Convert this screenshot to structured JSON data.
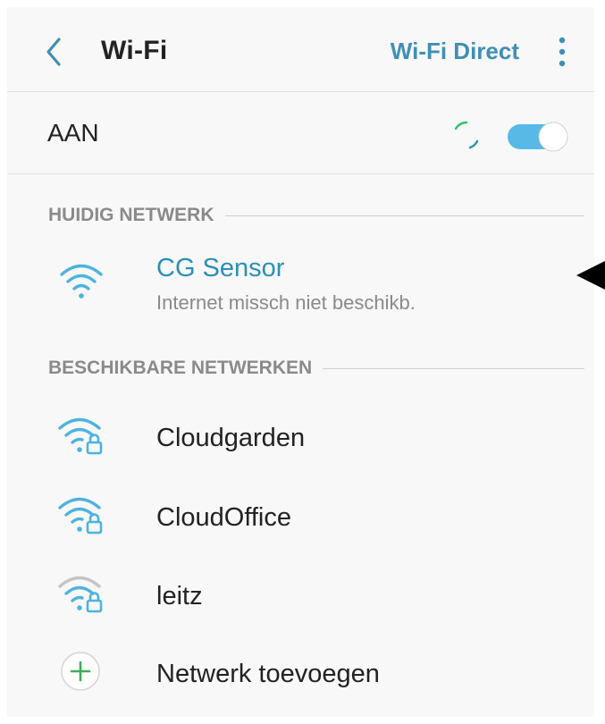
{
  "header": {
    "title": "Wi-Fi",
    "wifi_direct_label": "Wi-Fi Direct",
    "back_icon": "chevron-left-icon",
    "more_icon": "more-vertical-icon"
  },
  "toggle": {
    "label": "AAN",
    "state": "on",
    "connecting_icon": "spinner-icon"
  },
  "current_network": {
    "section_label": "HUIDIG NETWERK",
    "name": "CG Sensor",
    "status": "Internet missch niet beschikb.",
    "icon": "wifi-icon"
  },
  "available_networks": {
    "section_label": "BESCHIKBARE NETWERKEN",
    "items": [
      {
        "name": "Cloudgarden",
        "icon": "wifi-lock-icon",
        "signal": "strong"
      },
      {
        "name": "CloudOffice",
        "icon": "wifi-lock-icon",
        "signal": "strong"
      },
      {
        "name": "leitz",
        "icon": "wifi-lock-icon",
        "signal": "weak"
      }
    ]
  },
  "add_network": {
    "label": "Netwerk toevoegen",
    "icon": "plus-circle-icon"
  },
  "colors": {
    "accent": "#2b8fb8",
    "wifi_strong": "#4db3e0",
    "wifi_weak": "#c4c4c4",
    "switch_on": "#56b9e6",
    "spinner": "#2ec46a",
    "add_plus": "#3cae5c"
  }
}
